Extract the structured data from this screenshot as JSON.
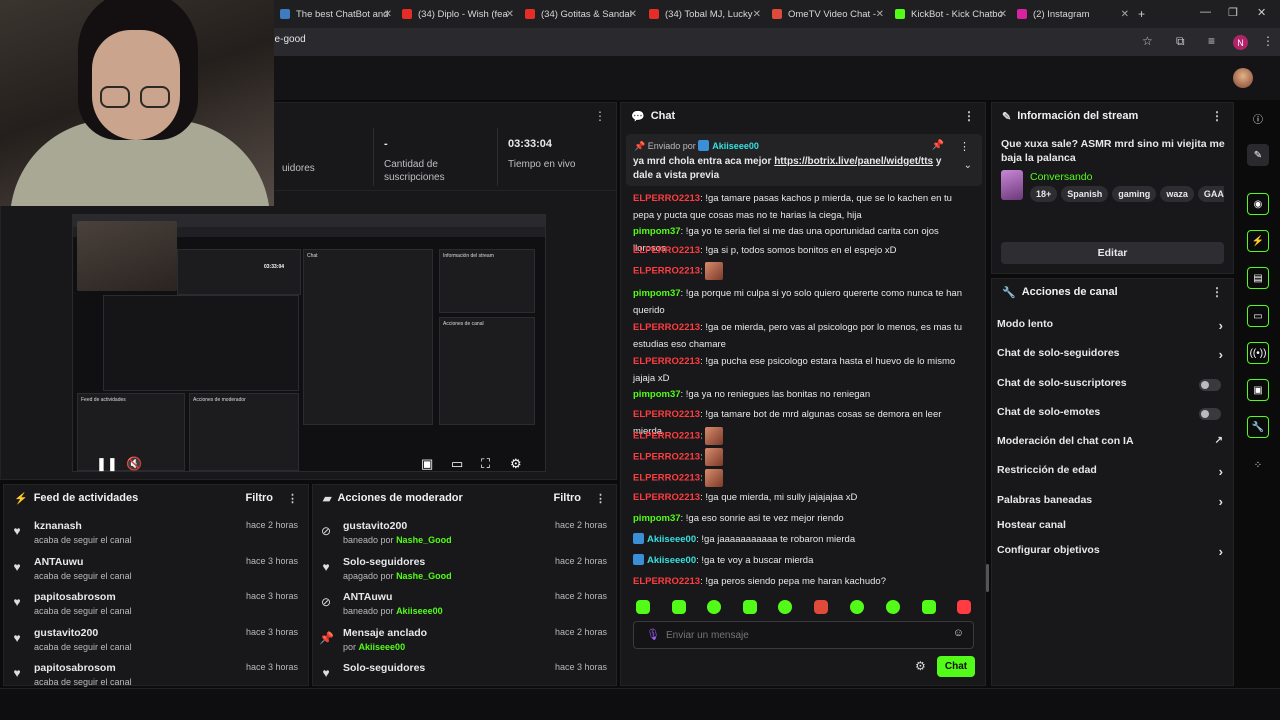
{
  "browser": {
    "tabs": [
      {
        "label": "The best ChatBot and",
        "color": "#3e7cc2"
      },
      {
        "label": "(34) Diplo - Wish (fea",
        "color": "#e52d27"
      },
      {
        "label": "(34) Gotitas & Sandal",
        "color": "#e52d27"
      },
      {
        "label": "(34) Tobal MJ, Lucky",
        "color": "#e52d27"
      },
      {
        "label": "OmeTV Video Chat -",
        "color": "#e04a3a"
      },
      {
        "label": "KickBot - Kick Chatbo",
        "color": "#53fc18"
      },
      {
        "label": "(2) Instagram",
        "color": "#d6249f"
      }
    ],
    "url": "she-good",
    "profile_initial": "N"
  },
  "stats": [
    {
      "value": "",
      "label": "uidores"
    },
    {
      "value": "-",
      "label": "Cantidad de suscripciones"
    },
    {
      "value": "03:33:04",
      "label": "Tiempo en vivo"
    }
  ],
  "feed": {
    "title": "Feed de actividades",
    "filter": "Filtro",
    "items": [
      {
        "name": "kznanash",
        "sub": "acaba de seguir el canal",
        "time": "hace 2 horas"
      },
      {
        "name": "ANTAuwu",
        "sub": "acaba de seguir el canal",
        "time": "hace 3 horas"
      },
      {
        "name": "papitosabrosom",
        "sub": "acaba de seguir el canal",
        "time": "hace 3 horas"
      },
      {
        "name": "gustavito200",
        "sub": "acaba de seguir el canal",
        "time": "hace 3 horas"
      },
      {
        "name": "papitosabrosom",
        "sub": "acaba de seguir el canal",
        "time": "hace 3 horas"
      }
    ]
  },
  "modactions": {
    "title": "Acciones de moderador",
    "filter": "Filtro",
    "items": [
      {
        "name": "gustavito200",
        "pre": "baneado por",
        "by": "Nashe_Good",
        "time": "hace 2 horas",
        "icon": "ban"
      },
      {
        "name": "Solo-seguidores",
        "pre": "apagado por",
        "by": "Nashe_Good",
        "time": "hace 2 horas",
        "icon": "heart"
      },
      {
        "name": "ANTAuwu",
        "pre": "baneado por",
        "by": "Akiiseee00",
        "time": "hace 2 horas",
        "icon": "ban"
      },
      {
        "name": "Mensaje anclado",
        "pre": "por",
        "by": "Akiiseee00",
        "time": "hace 2 horas",
        "icon": "pin"
      },
      {
        "name": "Solo-seguidores",
        "pre": "",
        "by": "",
        "time": "hace 3 horas",
        "icon": "heart"
      }
    ]
  },
  "chat": {
    "title": "Chat",
    "pinned": {
      "label": "Enviado por",
      "user": "Akiiseee00",
      "text": "ya mrd chola entra aca mejor",
      "link": "https://botrix.live/panel/widget/tts",
      "text2": "y dale a vista previa"
    },
    "messages": [
      {
        "user": "ELPERRO2213",
        "color": "red",
        "text": "!ga tamare pasas kachos p mierda, que se lo kachen en tu pepa y pucta que cosas mas no te harias la ciega, hija",
        "badge": false
      },
      {
        "user": "pimpom37",
        "color": "grn",
        "text": "!ga yo te seria fiel si me das una oportunidad carita con ojos llorosos",
        "badge": false
      },
      {
        "user": "ELPERRO2213",
        "color": "red",
        "text": "!ga si p, todos somos bonitos en el espejo xD",
        "badge": false
      },
      {
        "user": "ELPERRO2213",
        "color": "red",
        "text": "",
        "emote": true,
        "badge": false
      },
      {
        "user": "pimpom37",
        "color": "grn",
        "text": "!ga porque mi culpa si yo solo quiero quererte como nunca te han querido",
        "badge": false
      },
      {
        "user": "ELPERRO2213",
        "color": "red",
        "text": "!ga oe mierda, pero vas al psicologo por lo menos, es mas tu estudias eso chamare",
        "badge": false
      },
      {
        "user": "ELPERRO2213",
        "color": "red",
        "text": "!ga pucha ese psicologo estara hasta el huevo de lo mismo jajaja xD",
        "badge": false
      },
      {
        "user": "pimpom37",
        "color": "grn",
        "text": "!ga ya no reniegues las bonitas no reniegan",
        "badge": false
      },
      {
        "user": "ELPERRO2213",
        "color": "red",
        "text": "!ga tamare bot de mrd algunas cosas se demora en leer mierda",
        "badge": false
      },
      {
        "user": "ELPERRO2213",
        "color": "red",
        "text": "",
        "emote": true,
        "badge": false
      },
      {
        "user": "ELPERRO2213",
        "color": "red",
        "text": "",
        "emote": true,
        "badge": false
      },
      {
        "user": "ELPERRO2213",
        "color": "red",
        "text": "",
        "emote": true,
        "badge": false
      },
      {
        "user": "ELPERRO2213",
        "color": "red",
        "text": "!ga que mierda, mi sully jajajajaa xD",
        "badge": false
      },
      {
        "user": "pimpom37",
        "color": "grn",
        "text": "!ga eso sonrie asi te vez mejor riendo",
        "badge": false
      },
      {
        "user": "Akiiseee00",
        "color": "cyan",
        "text": "!ga jaaaaaaaaaaa te robaron mierda",
        "badge": true
      },
      {
        "user": "Akiiseee00",
        "color": "cyan",
        "text": "!ga te voy a buscar mierda",
        "badge": true
      },
      {
        "user": "ELPERRO2213",
        "color": "red",
        "text": "!ga peros siendo pepa me haran kachudo?",
        "badge": false
      }
    ],
    "placeholder": "Enviar un mensaje",
    "send": "Chat"
  },
  "info": {
    "title": "Información del stream",
    "stream_title": "Que xuxa sale? ASMR mrd sino mi viejita me baja la palanca",
    "category": "Conversando",
    "tags": [
      "18+",
      "Spanish",
      "gaming",
      "waza",
      "GAAAAA"
    ],
    "edit": "Editar"
  },
  "actions": {
    "title": "Acciones de canal",
    "items": [
      {
        "label": "Modo lento",
        "kind": "arrow"
      },
      {
        "label": "Chat de solo-seguidores",
        "kind": "arrow"
      },
      {
        "label": "Chat de solo-suscriptores",
        "kind": "toggle"
      },
      {
        "label": "Chat de solo-emotes",
        "kind": "toggle"
      },
      {
        "label": "Moderación del chat con IA",
        "kind": "ext"
      },
      {
        "label": "Restricción de edad",
        "kind": "arrow"
      },
      {
        "label": "Palabras baneadas",
        "kind": "arrow"
      },
      {
        "label": "Hostear canal",
        "kind": "none"
      },
      {
        "label": "Configurar objetivos",
        "kind": "arrow"
      }
    ]
  },
  "preview": {
    "mini_labels": [
      "Feed de actividades",
      "Acciones de moderador",
      "Chat",
      "Información del stream",
      "Acciones de canal"
    ],
    "mini_time": "03:33:04"
  }
}
